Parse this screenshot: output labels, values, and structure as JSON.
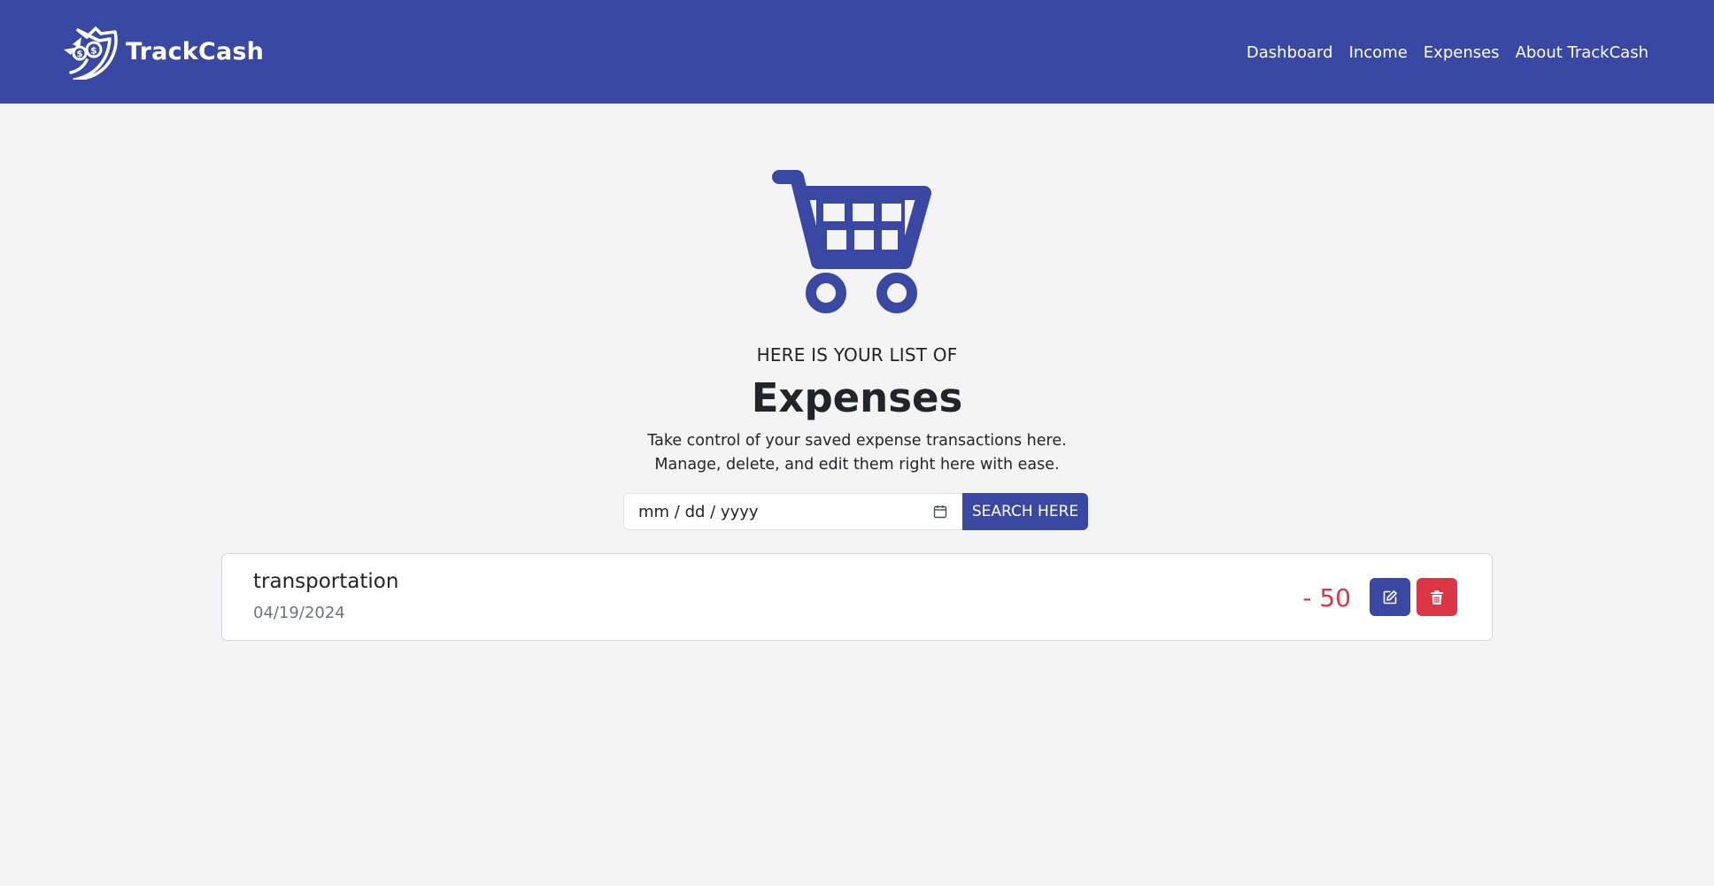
{
  "app": {
    "brand_name": "TrackCash",
    "colors": {
      "primary": "#3949a3",
      "danger": "#dc3545",
      "background": "#f4f4f5"
    }
  },
  "nav": {
    "items": [
      {
        "label": "Dashboard"
      },
      {
        "label": "Income"
      },
      {
        "label": "Expenses"
      },
      {
        "label": "About TrackCash"
      }
    ]
  },
  "hero": {
    "icon": "shopping-cart-icon",
    "eyebrow": "HERE IS YOUR LIST OF",
    "title": "Expenses",
    "subtitle_line1": "Take control of your saved expense transactions here.",
    "subtitle_line2": "Manage, delete, and edit them right here with ease."
  },
  "search": {
    "date_placeholder": "mm / dd / yyyy",
    "button_label": "SEARCH HERE"
  },
  "transactions": [
    {
      "title": "transportation",
      "date": "04/19/2024",
      "amount": "- 50",
      "edit_icon": "edit-icon",
      "delete_icon": "trash-icon"
    }
  ]
}
